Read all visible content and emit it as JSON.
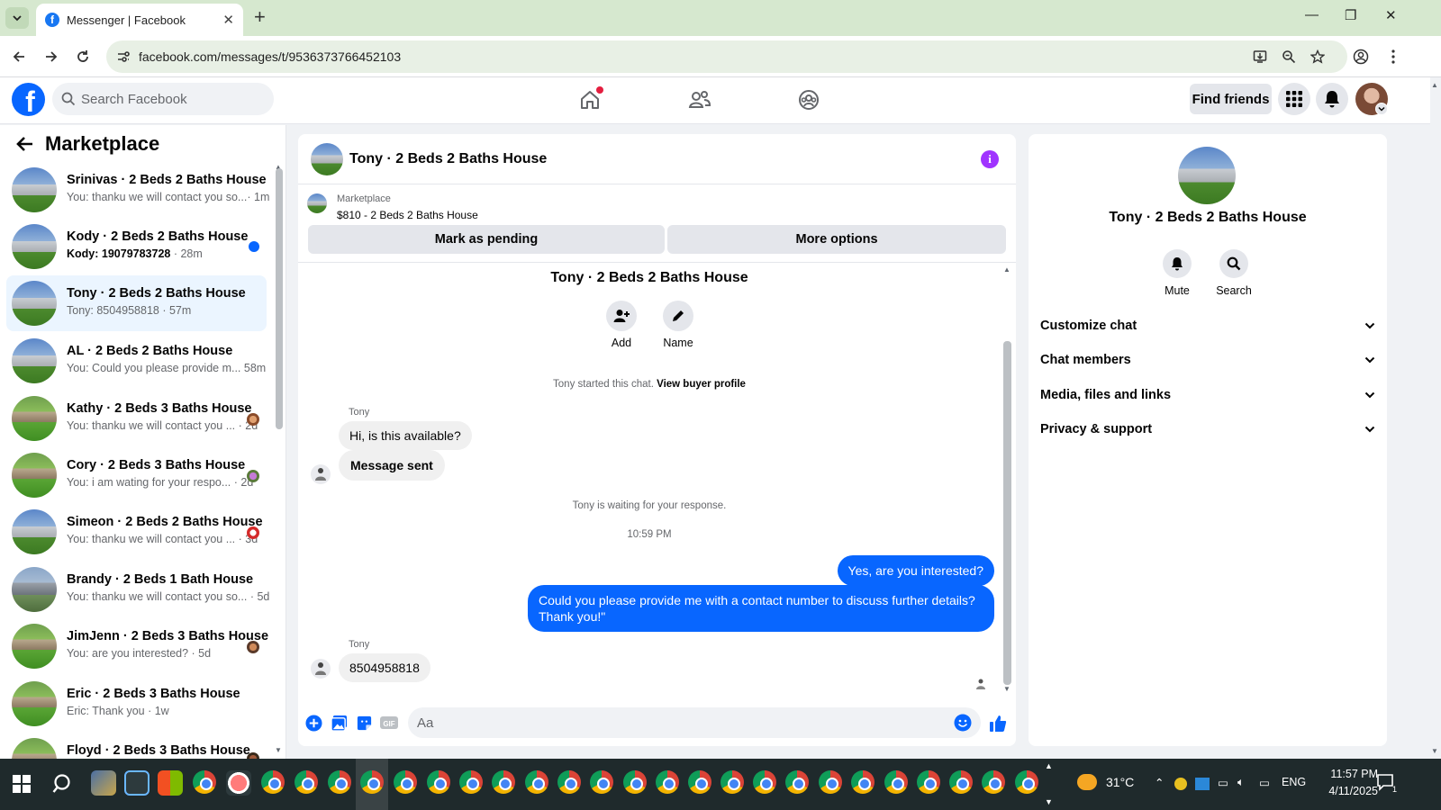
{
  "browser": {
    "tab_title": "Messenger | Facebook",
    "url": "facebook.com/messages/t/9536373766452103"
  },
  "fb": {
    "search_placeholder": "Search Facebook",
    "find_friends": "Find friends",
    "logo_letter": "f"
  },
  "sidebar": {
    "title": "Marketplace",
    "conversations": [
      {
        "name": "Srinivas · 2 Beds 2 Baths House",
        "preview": "You: thanku we will contact you so...",
        "time": "· 1m",
        "unread": false,
        "badge": "none"
      },
      {
        "name": "Kody · 2 Beds 2 Baths House",
        "preview": "Kody: 19079783728",
        "time": " · 28m",
        "unread": true,
        "badge": "blue-dot"
      },
      {
        "name": "Tony · 2 Beds 2 Baths House",
        "preview": "Tony: 8504958818",
        "time": " · 57m",
        "unread": false,
        "badge": "none",
        "active": true
      },
      {
        "name": "AL · 2 Beds 2 Baths House",
        "preview": "You: Could you please provide m...",
        "time": " 58m",
        "unread": false,
        "badge": "none"
      },
      {
        "name": "Kathy · 2 Beds 3 Baths House",
        "preview": "You: thanku we will contact you ...",
        "time": " · 2d",
        "unread": false,
        "badge": "avatar"
      },
      {
        "name": "Cory · 2 Beds 3 Baths House",
        "preview": "You: i am wating for your respo...",
        "time": " · 2d",
        "unread": false,
        "badge": "avatar"
      },
      {
        "name": "Simeon · 2 Beds 2 Baths House",
        "preview": "You: thanku we will contact you ...",
        "time": " · 3d",
        "unread": false,
        "badge": "avatar"
      },
      {
        "name": "Brandy · 2 Beds 1 Bath House",
        "preview": "You: thanku we will contact you so...",
        "time": " · 5d",
        "unread": false,
        "badge": "none"
      },
      {
        "name": "JimJenn · 2 Beds 3 Baths House",
        "preview": "You: are you interested?",
        "time": " · 5d",
        "unread": false,
        "badge": "avatar"
      },
      {
        "name": "Eric · 2 Beds 3 Baths House",
        "preview": "Eric: Thank you",
        "time": " · 1w",
        "unread": false,
        "badge": "none"
      },
      {
        "name": "Floyd · 2 Beds 3 Baths House",
        "preview": "",
        "time": "",
        "unread": false,
        "badge": "avatar"
      }
    ]
  },
  "chat": {
    "header_name": "Tony · 2 Beds 2 Baths House",
    "listing_label": "Marketplace",
    "listing_price": "$810 - 2 Beds 2 Baths House",
    "mark_pending": "Mark as pending",
    "more_options": "More options",
    "intro_name": "Tony · 2 Beds 2 Baths House",
    "intro_add": "Add",
    "intro_name_btn": "Name",
    "started_text": "Tony started this chat.",
    "view_profile": "View buyer profile",
    "sender_1": "Tony",
    "msg_in_1": "Hi, is this available?",
    "msg_in_2": "Message sent",
    "waiting_text": "Tony is waiting for your response.",
    "time_divider": "10:59 PM",
    "msg_out_1": "Yes, are you interested?",
    "msg_out_2": "Could you please provide me with a contact number to discuss further details? Thank you!\"",
    "sender_2": "Tony",
    "msg_in_3": "8504958818",
    "composer_placeholder": "Aa"
  },
  "info_panel": {
    "name": "Tony · 2 Beds 2 Baths House",
    "mute": "Mute",
    "search": "Search",
    "rows": [
      "Customize chat",
      "Chat members",
      "Media, files and links",
      "Privacy & support"
    ]
  },
  "taskbar": {
    "weather": "31°C",
    "lang": "ENG",
    "time": "11:57 PM",
    "date": "4/11/2025",
    "notif_count": "1"
  },
  "colors": {
    "messenger_blue": "#0866ff",
    "info_purple": "#a033ff",
    "active_row": "#ebf5ff"
  }
}
